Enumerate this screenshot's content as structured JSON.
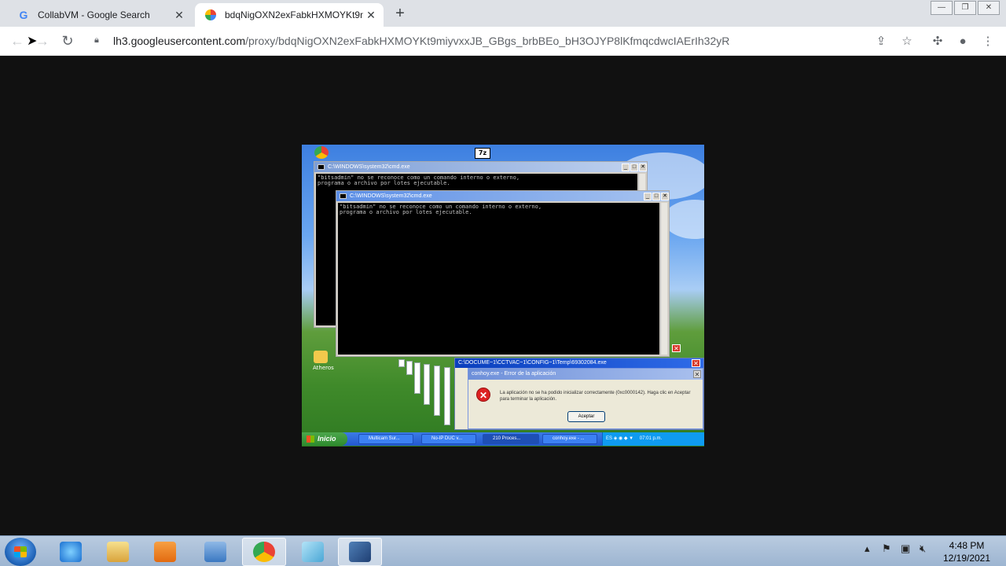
{
  "browser": {
    "tabs": [
      {
        "title": "CollabVM - Google Search",
        "favicon": "google-g-icon"
      },
      {
        "title": "bdqNigOXN2exFabkHXMOYKt9n",
        "favicon": "google-photos-pinwheel-icon"
      }
    ],
    "url_host": "lh3.googleusercontent.com",
    "url_path": "/proxy/bdqNigOXN2exFabkHXMOYKt9miyvxxJB_GBgs_brbBEo_bH3OJYP8lKfmqcdwcIAErIh32yR"
  },
  "xp_screen": {
    "top_window_label": "7z",
    "cmd_back": {
      "title": "C:\\WINDOWS\\system32\\cmd.exe",
      "output": "\"bitsadmin\" no se reconoce como un comando interno o externo,\nprograma o archivo por lotes ejecutable."
    },
    "cmd_front": {
      "title": "C:\\WINDOWS\\system32\\cmd.exe",
      "output": "\"bitsadmin\" no se reconoce como un comando interno o externo,\nprograma o archivo por lotes ejecutable."
    },
    "desktop_icons": [
      "Atheros"
    ],
    "exe_window_title": "C:\\DOCUME~1\\CCTVAC~1\\CONFIG~1\\Temp\\69302084.exe",
    "error_dialog": {
      "title": "conhoy.exe - Error de la aplicación",
      "message": "La aplicación no se ha podido inicializar correctamente (0xc0000142). Haga clic en Aceptar para terminar la aplicación.",
      "ok_label": "Aceptar"
    },
    "taskbar": {
      "start_label": "Inicio",
      "items": [
        "Multicam Sur...",
        "No-IP DUC v...",
        "210 Proces...",
        "conhoy.exe - ..."
      ],
      "tray_lang": "ES",
      "clock": "07:01 p.m."
    }
  },
  "win7_taskbar": {
    "time": "4:48 PM",
    "date": "12/19/2021"
  }
}
